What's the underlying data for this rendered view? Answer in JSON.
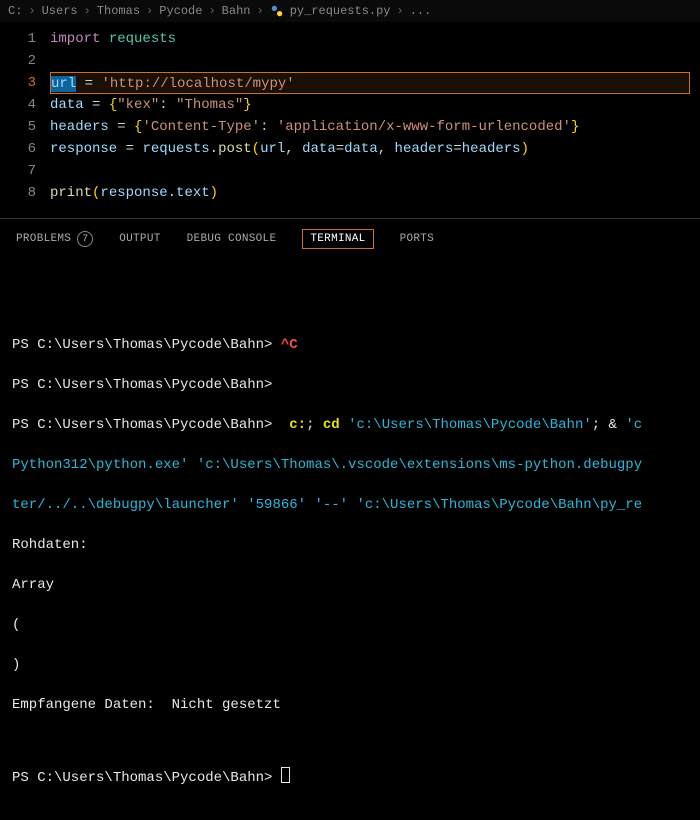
{
  "breadcrumb": {
    "parts": [
      "C:",
      "Users",
      "Thomas",
      "Pycode",
      "Bahn"
    ],
    "file": "py_requests.py",
    "trailing": "..."
  },
  "editor": {
    "line_numbers": [
      "1",
      "2",
      "3",
      "4",
      "5",
      "6",
      "7",
      "8"
    ],
    "current_line_index": 2,
    "tokens": {
      "l1_import": "import",
      "l1_requests": "requests",
      "l3_url": "url",
      "l3_eq": " = ",
      "l3_str": "'http://localhost/mypy'",
      "l4_data": "data",
      "l4_eq": " = ",
      "l4_brace_open": "{",
      "l4_k1": "\"kex\"",
      "l4_colon": ": ",
      "l4_v1": "\"Thomas\"",
      "l4_brace_close": "}",
      "l5_headers": "headers",
      "l5_eq": " = ",
      "l5_brace_open": "{",
      "l5_k1": "'Content-Type'",
      "l5_colon": ": ",
      "l5_v1": "'application/x-www-form-urlencoded'",
      "l5_brace_close": "}",
      "l6_response": "response",
      "l6_eq": " = ",
      "l6_requests": "requests",
      "l6_dot1": ".",
      "l6_post": "post",
      "l6_par_open": "(",
      "l6_arg_url": "url",
      "l6_c1": ", ",
      "l6_kw_data": "data",
      "l6_assign1": "=",
      "l6_val_data": "data",
      "l6_c2": ", ",
      "l6_kw_headers": "headers",
      "l6_assign2": "=",
      "l6_val_headers": "headers",
      "l6_par_close": ")",
      "l8_print": "print",
      "l8_par_open": "(",
      "l8_response": "response",
      "l8_dot": ".",
      "l8_text": "text",
      "l8_par_close": ")"
    }
  },
  "panel": {
    "tabs": {
      "problems": "PROBLEMS",
      "problems_count": "7",
      "output": "OUTPUT",
      "debug": "DEBUG CONSOLE",
      "terminal": "TERMINAL",
      "ports": "PORTS"
    },
    "active": "terminal"
  },
  "terminal": {
    "prompt": "PS C:\\Users\\Thomas\\Pycode\\Bahn>",
    "ctrl_c": "^C",
    "cmd_line_pre": " ",
    "cmd_c": "c:",
    "cmd_sep1": "; ",
    "cmd_cd": "cd",
    "cmd_cd_arg": " 'c:\\Users\\Thomas\\Pycode\\Bahn'",
    "cmd_sep2": "; & ",
    "cmd_tail1": "'c",
    "wrap1": "Python312\\python.exe' 'c:\\Users\\Thomas\\.vscode\\extensions\\ms-python.debugpy",
    "wrap2": "ter/../..\\debugpy\\launcher' '59866' '--' 'c:\\Users\\Thomas\\Pycode\\Bahn\\py_re",
    "out1": "Rohdaten:",
    "out2": "Array",
    "out3": "(",
    "out4": ")",
    "out5": "Empfangene Daten:  Nicht gesetzt"
  }
}
